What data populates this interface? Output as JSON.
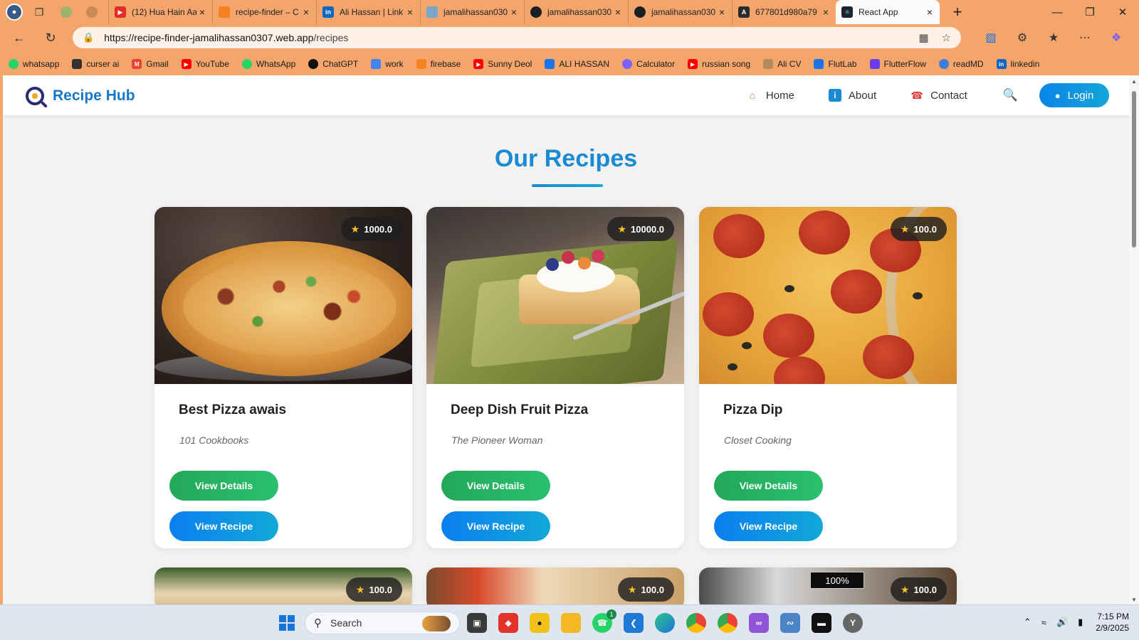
{
  "browser": {
    "tabs": [
      {
        "title": "(12) Hua Hain Aa",
        "icon_color": "#e52d27"
      },
      {
        "title": "recipe-finder – C",
        "icon_color": "#f58220"
      },
      {
        "title": "Ali Hassan | Link",
        "icon_color": "#0a66c2"
      },
      {
        "title": "jamalihassan030",
        "icon_color": "#7aa7c7"
      },
      {
        "title": "jamalihassan030",
        "icon_color": "#1b1f23"
      },
      {
        "title": "jamalihassan030",
        "icon_color": "#1b1f23"
      },
      {
        "title": "677801d980a79",
        "icon_color": "#2b2b2b"
      },
      {
        "title": "React App",
        "icon_color": "#20232a",
        "active": true
      }
    ],
    "url_host": "https://recipe-finder-jamalihassan0307.web.app",
    "url_path": "/recipes",
    "bookmarks": [
      {
        "label": "whatsapp",
        "color": "#25d366"
      },
      {
        "label": "curser ai",
        "color": "#333333"
      },
      {
        "label": "Gmail",
        "color": "#ea4335"
      },
      {
        "label": "YouTube",
        "color": "#ff0000"
      },
      {
        "label": "WhatsApp",
        "color": "#25d366"
      },
      {
        "label": "ChatGPT",
        "color": "#111111"
      },
      {
        "label": "work",
        "color": "#4285f4"
      },
      {
        "label": "firebase",
        "color": "#f58220"
      },
      {
        "label": "Sunny Deol",
        "color": "#ff0000"
      },
      {
        "label": "ALI HASSAN",
        "color": "#1a73e8"
      },
      {
        "label": "Calculator",
        "color": "#7b61ff"
      },
      {
        "label": "russian song",
        "color": "#ff0000"
      },
      {
        "label": "Ali CV",
        "color": "#b38b5d"
      },
      {
        "label": "FlutLab",
        "color": "#1a73e8"
      },
      {
        "label": "FlutterFlow",
        "color": "#6a3de8"
      },
      {
        "label": "readMD",
        "color": "#3b7dd8"
      },
      {
        "label": "linkedin",
        "color": "#0a66c2"
      }
    ]
  },
  "app": {
    "brand": "Recipe Hub",
    "nav": {
      "home": "Home",
      "about": "About",
      "contact": "Contact",
      "login": "Login"
    },
    "page_title": "Our Recipes",
    "recipes": [
      {
        "title": "Best Pizza awais",
        "publisher": "101 Cookbooks",
        "rating": "1000.0",
        "details_label": "View Details",
        "recipe_label": "View Recipe"
      },
      {
        "title": "Deep Dish Fruit Pizza",
        "publisher": "The Pioneer Woman",
        "rating": "10000.0",
        "details_label": "View Details",
        "recipe_label": "View Recipe"
      },
      {
        "title": "Pizza Dip",
        "publisher": "Closet Cooking",
        "rating": "100.0",
        "details_label": "View Details",
        "recipe_label": "View Recipe"
      }
    ],
    "next_row_ratings": [
      "100.0",
      "100.0",
      "100.0"
    ],
    "zoom": "100%"
  },
  "taskbar": {
    "search_placeholder": "Search",
    "time": "7:15 PM",
    "date": "2/9/2025",
    "whatsapp_badge": "1"
  },
  "colors": {
    "accent": "#1a8ad4",
    "details_button": "#23a85a",
    "recipe_button": "#0a7ff0",
    "browser_frame": "#f3a56b"
  }
}
